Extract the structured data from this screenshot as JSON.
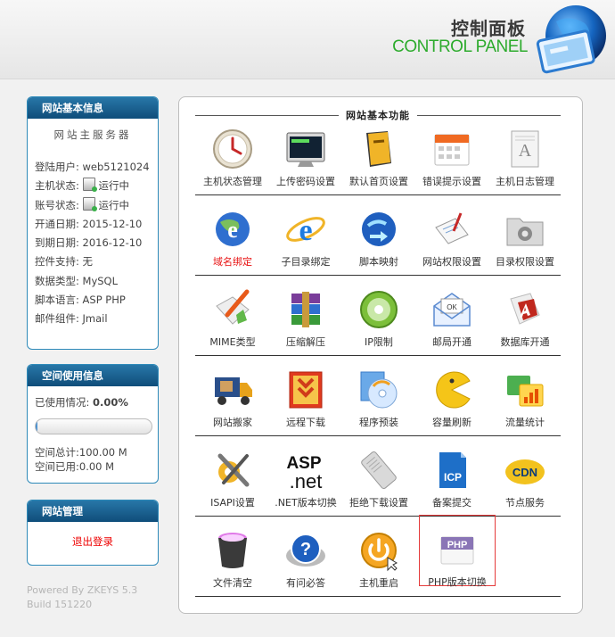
{
  "header": {
    "title_cn": "控制面板",
    "title_en": "CONTROL PANEL"
  },
  "site_info": {
    "title": "网站基本信息",
    "subtitle": "网站主服务器",
    "rows": [
      {
        "label": "登陆用户:",
        "value": "web5121024"
      },
      {
        "label": "主机状态:",
        "value": "运行中",
        "icon": "status-icon"
      },
      {
        "label": "账号状态:",
        "value": "运行中",
        "icon": "status-icon"
      },
      {
        "label": "开通日期:",
        "value": "2015-12-10"
      },
      {
        "label": "到期日期:",
        "value": "2016-12-10"
      },
      {
        "label": "控件支持:",
        "value": "无"
      },
      {
        "label": "数据类型:",
        "value": "MySQL"
      },
      {
        "label": "脚本语言:",
        "value": "ASP PHP"
      },
      {
        "label": "邮件组件:",
        "value": "Jmail"
      }
    ]
  },
  "space_info": {
    "title": "空间使用信息",
    "used_label": "已使用情况:",
    "used_value": "0.00%",
    "used_fraction": 0.0,
    "total": "空间总计:100.00 M",
    "used": "空间已用:0.00 M"
  },
  "site_manage": {
    "title": "网站管理",
    "logout": "退出登录"
  },
  "powered": {
    "line1": "Powered By ZKEYS 5.3",
    "line2": "Build 151220"
  },
  "main": {
    "title": "网站基本功能",
    "rows": [
      [
        {
          "label": "主机状态管理",
          "icon": "clock-status-icon"
        },
        {
          "label": "上传密码设置",
          "icon": "ftp-terminal-icon"
        },
        {
          "label": "默认首页设置",
          "icon": "book-icon"
        },
        {
          "label": "错误提示设置",
          "icon": "calendar-icon"
        },
        {
          "label": "主机日志管理",
          "icon": "log-document-icon"
        }
      ],
      [
        {
          "label": "域名绑定",
          "icon": "ie-globe-icon",
          "red": true
        },
        {
          "label": "子目录绑定",
          "icon": "ie-subdir-icon"
        },
        {
          "label": "脚本映射",
          "icon": "globe-arrows-icon"
        },
        {
          "label": "网站权限设置",
          "icon": "clipboard-pen-icon"
        },
        {
          "label": "目录权限设置",
          "icon": "folder-gear-icon"
        }
      ],
      [
        {
          "label": "MIME类型",
          "icon": "paint-brush-icon"
        },
        {
          "label": "压缩解压",
          "icon": "winrar-icon"
        },
        {
          "label": "IP限制",
          "icon": "ip-disc-icon"
        },
        {
          "label": "邮局开通",
          "icon": "mail-envelope-icon"
        },
        {
          "label": "数据库开通",
          "icon": "access-database-icon"
        }
      ],
      [
        {
          "label": "网站搬家",
          "icon": "moving-truck-icon"
        },
        {
          "label": "远程下载",
          "icon": "download-arrow-icon"
        },
        {
          "label": "程序预装",
          "icon": "install-disc-icon"
        },
        {
          "label": "容量刷新",
          "icon": "pacman-refresh-icon"
        },
        {
          "label": "流量统计",
          "icon": "traffic-chart-icon"
        }
      ],
      [
        {
          "label": "ISAPI设置",
          "icon": "tools-wrench-icon"
        },
        {
          "label": ".NET版本切换",
          "icon": "asp-net-icon"
        },
        {
          "label": "拒绝下载设置",
          "icon": "deny-download-icon"
        },
        {
          "label": "备案提交",
          "icon": "icp-icon"
        },
        {
          "label": "节点服务",
          "icon": "cdn-node-icon"
        }
      ],
      [
        {
          "label": "文件清空",
          "icon": "trash-bin-icon"
        },
        {
          "label": "有问必答",
          "icon": "help-question-icon"
        },
        {
          "label": "主机重启",
          "icon": "power-restart-icon"
        },
        {
          "label": "PHP版本切换",
          "icon": "php-icon",
          "selected": true
        }
      ]
    ],
    "asp_text": "ASP",
    "net_text": ".net",
    "icp_text": "ICP",
    "php_text": "PHP",
    "cdn_text": "CDN",
    "ok_text": "OK"
  }
}
